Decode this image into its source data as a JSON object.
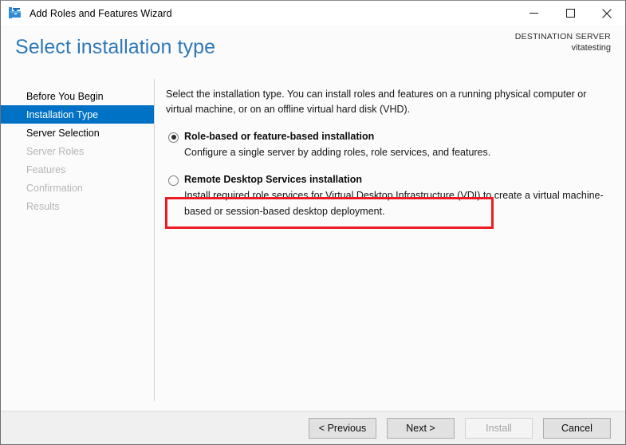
{
  "window": {
    "title": "Add Roles and Features Wizard",
    "icon": "server-manager-toolbox-icon",
    "controls": {
      "minimize": "minimize-icon",
      "maximize": "maximize-icon",
      "close": "close-icon"
    }
  },
  "header": {
    "page_title": "Select installation type",
    "destination_label": "DESTINATION SERVER",
    "destination_value": "vitatesting"
  },
  "sidebar": {
    "items": [
      {
        "label": "Before You Begin",
        "state": "normal"
      },
      {
        "label": "Installation Type",
        "state": "selected"
      },
      {
        "label": "Server Selection",
        "state": "normal"
      },
      {
        "label": "Server Roles",
        "state": "disabled"
      },
      {
        "label": "Features",
        "state": "disabled"
      },
      {
        "label": "Confirmation",
        "state": "disabled"
      },
      {
        "label": "Results",
        "state": "disabled"
      }
    ]
  },
  "main": {
    "intro": "Select the installation type. You can install roles and features on a running physical computer or virtual machine, or on an offline virtual hard disk (VHD).",
    "options": [
      {
        "title": "Role-based or feature-based installation",
        "description": "Configure a single server by adding roles, role services, and features.",
        "selected": true
      },
      {
        "title": "Remote Desktop Services installation",
        "description": "Install required role services for Virtual Desktop Infrastructure (VDI) to create a virtual machine-based or session-based desktop deployment.",
        "selected": false
      }
    ],
    "annotation": {
      "shape": "rectangle",
      "color": "#ed1c24",
      "targets": "role-based-installation-option"
    }
  },
  "footer": {
    "buttons": [
      {
        "label": "< Previous",
        "enabled": true
      },
      {
        "label": "Next >",
        "enabled": true
      },
      {
        "label": "Install",
        "enabled": false
      },
      {
        "label": "Cancel",
        "enabled": true
      }
    ]
  },
  "colors": {
    "accent_blue": "#0072c6",
    "title_blue": "#2e78b8",
    "annotation_red": "#ed1c24",
    "footer_gray": "#f0f0f0",
    "disabled_text": "#b6b6b6"
  }
}
